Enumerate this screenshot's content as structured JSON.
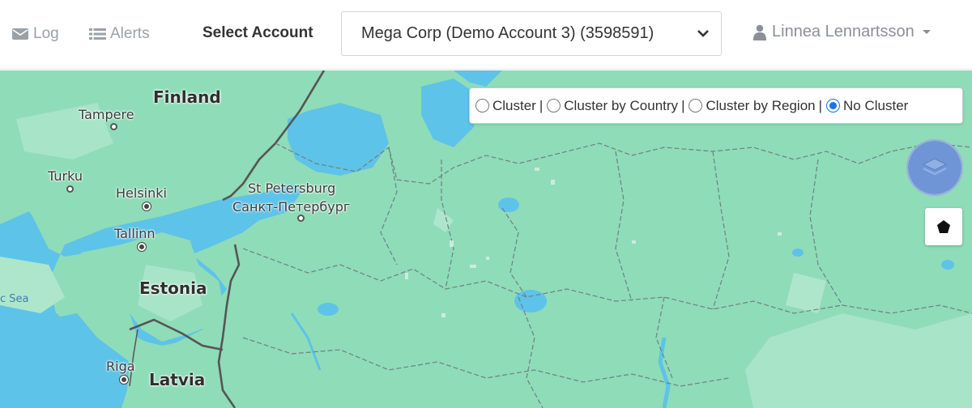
{
  "header": {
    "log_label": "Log",
    "alerts_label": "Alerts",
    "select_account_label": "Select Account",
    "account_value": "Mega Corp (Demo Account 3) (3598591)",
    "user_name": "Linnea Lennartsson",
    "icons": {
      "log": "envelope-icon",
      "alerts": "list-icon",
      "select": "chevron-down-icon",
      "user": "user-icon"
    }
  },
  "map": {
    "labels": {
      "finland": "Finland",
      "tampere": "Tampere",
      "turku": "Turku",
      "helsinki": "Helsinki",
      "st_petersburg": "St Petersburg",
      "st_petersburg_ru": "Санкт-Петербург",
      "tallinn": "Tallinn",
      "estonia": "Estonia",
      "baltic_sea": "c Sea",
      "riga": "Riga",
      "latvia": "Latvia"
    },
    "colors": {
      "land": "#8fdcb8",
      "water": "#5ec3e8",
      "forest": "#aee6cb",
      "border": "#555555"
    },
    "cluster_options": {
      "cluster": "Cluster",
      "by_country": "Cluster by Country",
      "by_region": "Cluster by Region",
      "no_cluster": "No Cluster",
      "separator": "|",
      "selected": "No Cluster"
    },
    "controls": {
      "layers": "layers-icon",
      "polygon": "pentagon-icon"
    }
  }
}
